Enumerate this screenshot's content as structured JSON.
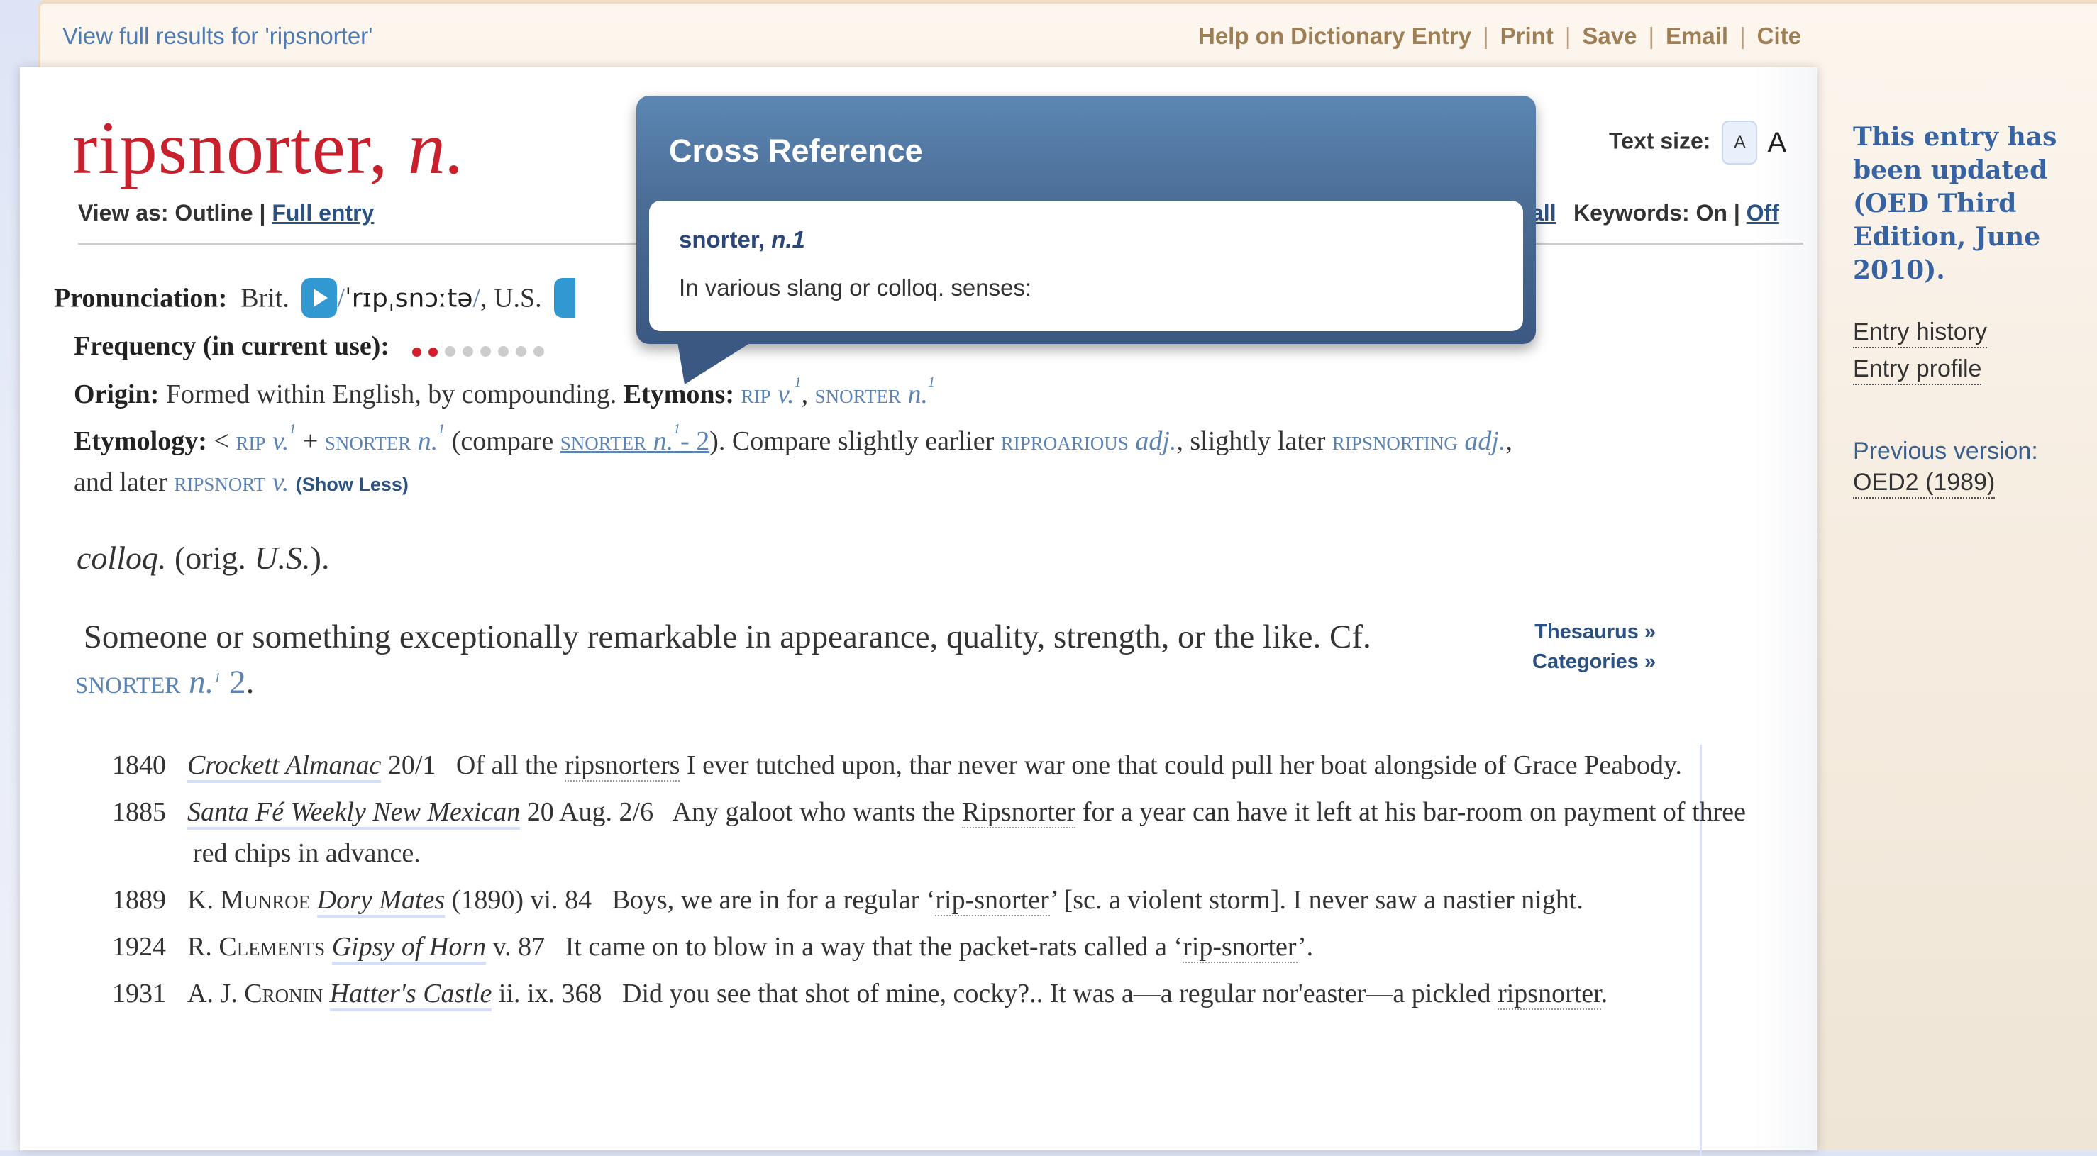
{
  "topbar": {
    "results_link": "View full results for 'ripsnorter'",
    "actions": [
      "Help on Dictionary Entry",
      "Print",
      "Save",
      "Email",
      "Cite"
    ]
  },
  "entry": {
    "headword": "ripsnorter,",
    "pos": "n.",
    "view_as_label": "View as: Outline |",
    "full_entry_link": "Full entry",
    "text_size_label": "Text size:",
    "text_size_small": "A",
    "text_size_large": "A",
    "hidden_link": "all",
    "keywords_label": "Keywords: On |",
    "keywords_off": "Off",
    "pronunciation": {
      "label": "Pronunciation:",
      "brit": "Brit.",
      "ipa": "ˈrɪpˌsnɔːtə",
      "us": ", U.S."
    },
    "frequency": {
      "label": "Frequency (in current use):",
      "band": 2,
      "max": 8
    },
    "origin": {
      "label": "Origin:",
      "text": "Formed within English, by compounding.",
      "etymons_label": "Etymons:",
      "etymon1": "rip",
      "etymon1_pos": "v.",
      "etymon1_sup": "1",
      "sep": ",",
      "etymon2": "snorter",
      "etymon2_pos": "n.",
      "etymon2_sup": "1"
    },
    "etymology": {
      "label": "Etymology:",
      "lt": "<",
      "rip": "rip",
      "rip_pos": "v.",
      "rip_sup": "1",
      "plus": "+",
      "snorter": "snorter",
      "snorter_pos": "n.",
      "snorter_sup": "1",
      "compare_open": "(compare",
      "cmp_word": "snorter",
      "cmp_pos": "n.",
      "cmp_sup": "1",
      "cmp_sense": "- 2",
      "compare_close": "). Compare slightly earlier",
      "riproarious": "riproarious",
      "riproarious_pos": "adj.",
      "slightly_later": ", slightly later",
      "ripsnorting": "ripsnorting",
      "ripsnorting_pos": "adj.",
      "comma": ",",
      "and_later": "and later",
      "ripsnort": "ripsnort",
      "ripsnort_pos": "v.",
      "show_less": "(Show Less)"
    },
    "label_colloq": "colloq.",
    "label_orig": "(orig.",
    "label_us": "U.S.",
    "label_close": ").",
    "definition": "Someone or something exceptionally remarkable in appearance, quality, strength, or the like. Cf.",
    "def_xref": "snorter",
    "def_xref_pos": "n.",
    "def_xref_sup": "1",
    "def_xref_sense": "2",
    "def_end": ".",
    "thesaurus_link": "Thesaurus »",
    "categories_link": "Categories »",
    "quotations": [
      {
        "year": "1840",
        "author": "",
        "title": "Crockett Almanac",
        "ref": "20/1",
        "pre": "Of all the ",
        "kw": "ripsnorters",
        "post": " I ever tutched upon, thar never war one that could pull her boat alongside of Grace Peabody."
      },
      {
        "year": "1885",
        "author": "",
        "title": "Santa Fé Weekly New Mexican",
        "ref": "20 Aug. 2/6",
        "pre": "Any galoot who wants the ",
        "kw": "Ripsnorter",
        "post": " for a year can have it left at his bar-room on payment of three red chips in advance."
      },
      {
        "year": "1889",
        "author": "K. Munroe",
        "title": "Dory Mates",
        "ref": "(1890) vi. 84",
        "pre": "Boys, we are in for a regular ‘",
        "kw": "rip-snorter",
        "post": "’ [sc. a violent storm]. I never saw a nastier night."
      },
      {
        "year": "1924",
        "author": "R. Clements",
        "title": "Gipsy of Horn",
        "ref": "v. 87",
        "pre": "It came on to blow in a way that the packet-rats called a ‘",
        "kw": "rip-snorter",
        "post": "’."
      },
      {
        "year": "1931",
        "author": "A. J. Cronin",
        "title": "Hatter's Castle",
        "ref": "ii. ix. 368",
        "pre": "Did you see that shot of mine, cocky?.. It was a—a regular nor'easter—a pickled ",
        "kw": "ripsnorter",
        "post": "."
      }
    ]
  },
  "popup": {
    "title": "Cross Reference",
    "headword": "snorter,",
    "headword_pos": "n.1",
    "definition": "In various slang or colloq. senses:"
  },
  "sidebar": {
    "updated_notice": "This entry has been updated (OED Third Edition, June 2010).",
    "links": [
      "Entry history",
      "Entry profile"
    ],
    "previous_label": "Previous version:",
    "previous_link": "OED2 (1989)"
  },
  "colors": {
    "headword": "#c8202c",
    "link_blue": "#2c5282",
    "xref_blue": "#5b83b3",
    "toolbar_brown": "#9e7f55",
    "popup_header": "#4a6c95",
    "updated_blue": "#3763a3"
  }
}
